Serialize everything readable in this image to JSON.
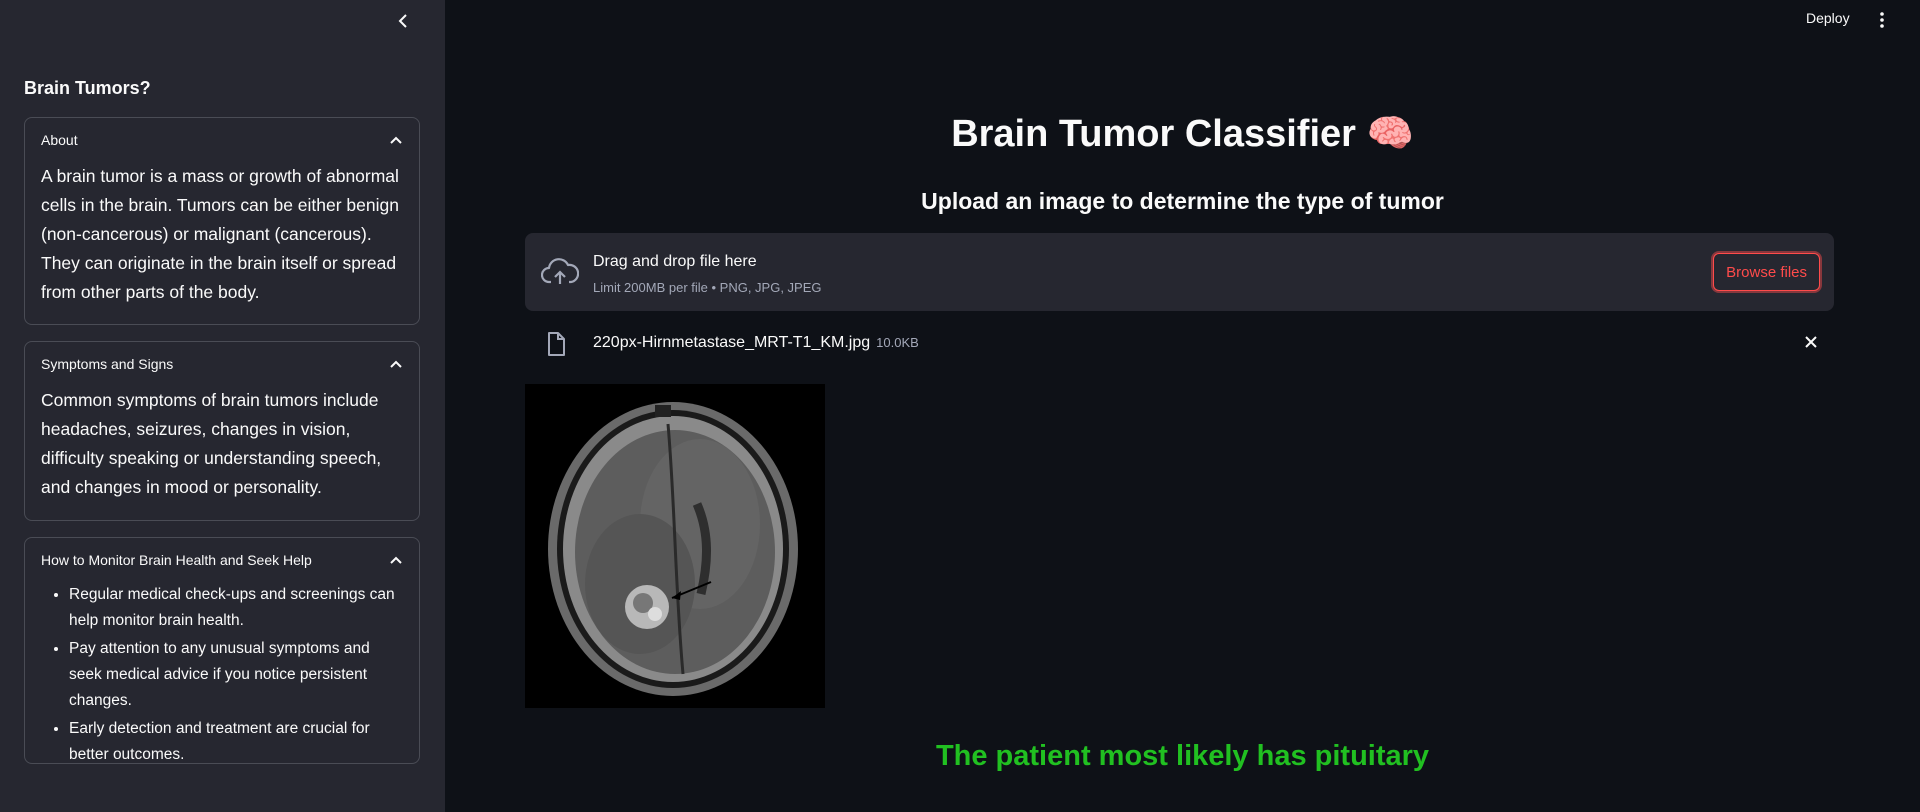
{
  "sidebar": {
    "title": "Brain Tumors?",
    "sections": [
      {
        "header": "About",
        "text": "A brain tumor is a mass or growth of abnormal cells in the brain. Tumors can be either benign (non-cancerous) or malignant (cancerous). They can originate in the brain itself or spread from other parts of the body."
      },
      {
        "header": "Symptoms and Signs",
        "text": "Common symptoms of brain tumors include headaches, seizures, changes in vision, difficulty speaking or understanding speech, and changes in mood or personality."
      },
      {
        "header": "How to Monitor Brain Health and Seek Help",
        "items": [
          "Regular medical check-ups and screenings can help monitor brain health.",
          "Pay attention to any unusual symptoms and seek medical advice if you notice persistent changes.",
          "Early detection and treatment are crucial for better outcomes."
        ]
      }
    ]
  },
  "header": {
    "deploy_label": "Deploy"
  },
  "main": {
    "title": "Brain Tumor Classifier 🧠",
    "subtitle": "Upload an image to determine the type of tumor",
    "uploader": {
      "primary_text": "Drag and drop file here",
      "secondary_text": "Limit 200MB per file • PNG, JPG, JPEG",
      "browse_label": "Browse files"
    },
    "file": {
      "name": "220px-Hirnmetastase_MRT-T1_KM.jpg",
      "size": "10.0KB"
    },
    "result": "The patient most likely has pituitary"
  },
  "colors": {
    "accent": "#ff4b4b",
    "result": "#21c021",
    "sidebar_bg": "#262730",
    "main_bg": "#0e1117"
  }
}
